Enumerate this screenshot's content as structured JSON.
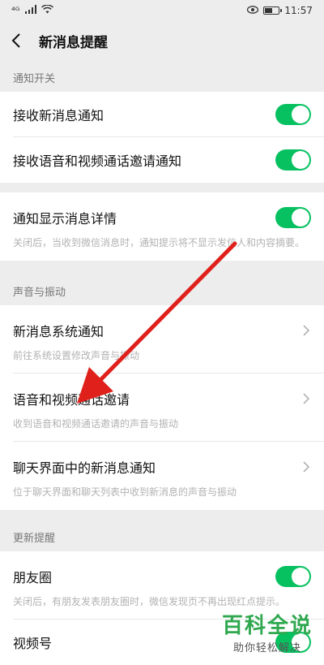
{
  "statusbar": {
    "signal_text": "⁴ᴳ",
    "time": "11:57",
    "battery_level": 0.6
  },
  "nav": {
    "title": "新消息提醒",
    "back_icon": "back-chevron-icon"
  },
  "sections": {
    "notify_switch": {
      "title": "通知开关",
      "receive_new": "接收新消息通知",
      "receive_call": "接收语音和视频通话邀请通知"
    },
    "detail": {
      "title": "通知显示消息详情",
      "desc": "关闭后，当收到微信消息时，通知提示将不显示发信人和内容摘要。"
    },
    "sound": {
      "title": "声音与振动",
      "items": [
        {
          "title": "新消息系统通知",
          "desc": "前往系统设置修改声音与振动"
        },
        {
          "title": "语音和视频通话邀请",
          "desc": "收到语音和视频通话邀请的声音与振动"
        },
        {
          "title": "聊天界面中的新消息通知",
          "desc": "位于聊天界面和聊天列表中收到新消息的声音与振动"
        }
      ]
    },
    "update": {
      "title": "更新提醒",
      "moments": "朋友圈",
      "moments_desc": "关闭后，有朋友发表朋友圈时，微信发现页不再出现红点提示。",
      "channels": "视频号"
    }
  },
  "toggles": {
    "receive_new": true,
    "receive_call": true,
    "detail": true,
    "moments": true,
    "channels": true
  },
  "colors": {
    "accent": "#07c160",
    "annotation_arrow": "#e0201b",
    "watermark": "#2fa84f"
  },
  "watermark": {
    "main": "百科全说",
    "sub": "助你轻松解决"
  }
}
